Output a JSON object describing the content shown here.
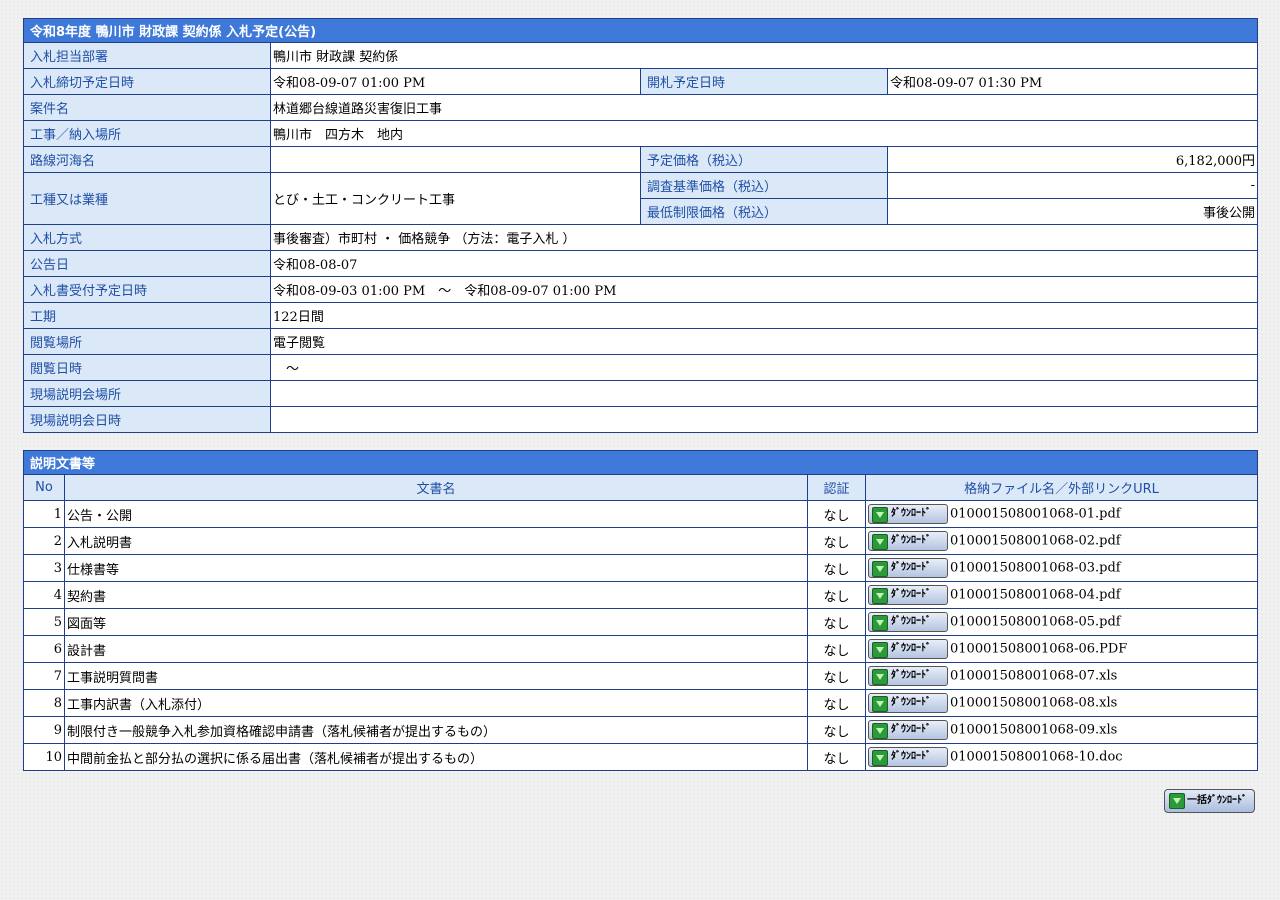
{
  "notice": {
    "title": "令和8年度 鴨川市 財政課 契約係 入札予定(公告)",
    "department_label": "入札担当部署",
    "department": "鴨川市 財政課 契約係",
    "deadline_label": "入札締切予定日時",
    "deadline": "令和08-09-07 01:00 PM",
    "opening_label": "開札予定日時",
    "opening": "令和08-09-07 01:30 PM",
    "project_label": "案件名",
    "project": "林道郷台線道路災害復旧工事",
    "location_label": "工事／納入場所",
    "location": "鴨川市　四方木　地内",
    "route_label": "路線河海名",
    "route": "",
    "estimated_price_label": "予定価格（税込）",
    "estimated_price": "6,182,000円",
    "category_label": "工種又は業種",
    "category": "とび・土工・コンクリート工事",
    "survey_price_label": "調査基準価格（税込）",
    "survey_price": "-",
    "min_price_label": "最低制限価格（税込）",
    "min_price": "事後公開",
    "method_label": "入札方式",
    "method": "事後審査）市町村 ・ 価格競争 （方法：電子入札 ）",
    "announce_date_label": "公告日",
    "announce_date": "令和08-08-07",
    "receipt_period_label": "入札書受付予定日時",
    "receipt_period": "令和08-09-03 01:00 PM　～　令和08-09-07 01:00 PM",
    "construction_period_label": "工期",
    "construction_period": "122日間",
    "viewing_place_label": "閲覧場所",
    "viewing_place": "電子閲覧",
    "viewing_time_label": "閲覧日時",
    "viewing_time": "　～",
    "briefing_place_label": "現場説明会場所",
    "briefing_place": "",
    "briefing_time_label": "現場説明会日時",
    "briefing_time": ""
  },
  "documents": {
    "title": "説明文書等",
    "headers": {
      "no": "No",
      "name": "文書名",
      "auth": "認証",
      "file": "格納ファイル名／外部リンクURL"
    },
    "download_label": "ﾀﾞｳﾝﾛｰﾄﾞ",
    "rows": [
      {
        "no": "1",
        "name": "公告・公開",
        "auth": "なし",
        "file": "010001508001068-01.pdf"
      },
      {
        "no": "2",
        "name": "入札説明書",
        "auth": "なし",
        "file": "010001508001068-02.pdf"
      },
      {
        "no": "3",
        "name": "仕様書等",
        "auth": "なし",
        "file": "010001508001068-03.pdf"
      },
      {
        "no": "4",
        "name": "契約書",
        "auth": "なし",
        "file": "010001508001068-04.pdf"
      },
      {
        "no": "5",
        "name": "図面等",
        "auth": "なし",
        "file": "010001508001068-05.pdf"
      },
      {
        "no": "6",
        "name": "設計書",
        "auth": "なし",
        "file": "010001508001068-06.PDF"
      },
      {
        "no": "7",
        "name": "工事説明質問書",
        "auth": "なし",
        "file": "010001508001068-07.xls"
      },
      {
        "no": "8",
        "name": "工事内訳書（入札添付）",
        "auth": "なし",
        "file": "010001508001068-08.xls"
      },
      {
        "no": "9",
        "name": "制限付き一般競争入札参加資格確認申請書（落札候補者が提出するもの）",
        "auth": "なし",
        "file": "010001508001068-09.xls"
      },
      {
        "no": "10",
        "name": "中間前金払と部分払の選択に係る届出書（落札候補者が提出するもの）",
        "auth": "なし",
        "file": "010001508001068-10.doc"
      }
    ],
    "bulk_download_label": "一括ﾀﾞｳﾝﾛｰﾄﾞ"
  },
  "colors": {
    "caption_bg": "#3e78d8",
    "label_bg": "#dbe8f7",
    "label_text": "#1f4fa7",
    "border": "#1f3f8a"
  }
}
